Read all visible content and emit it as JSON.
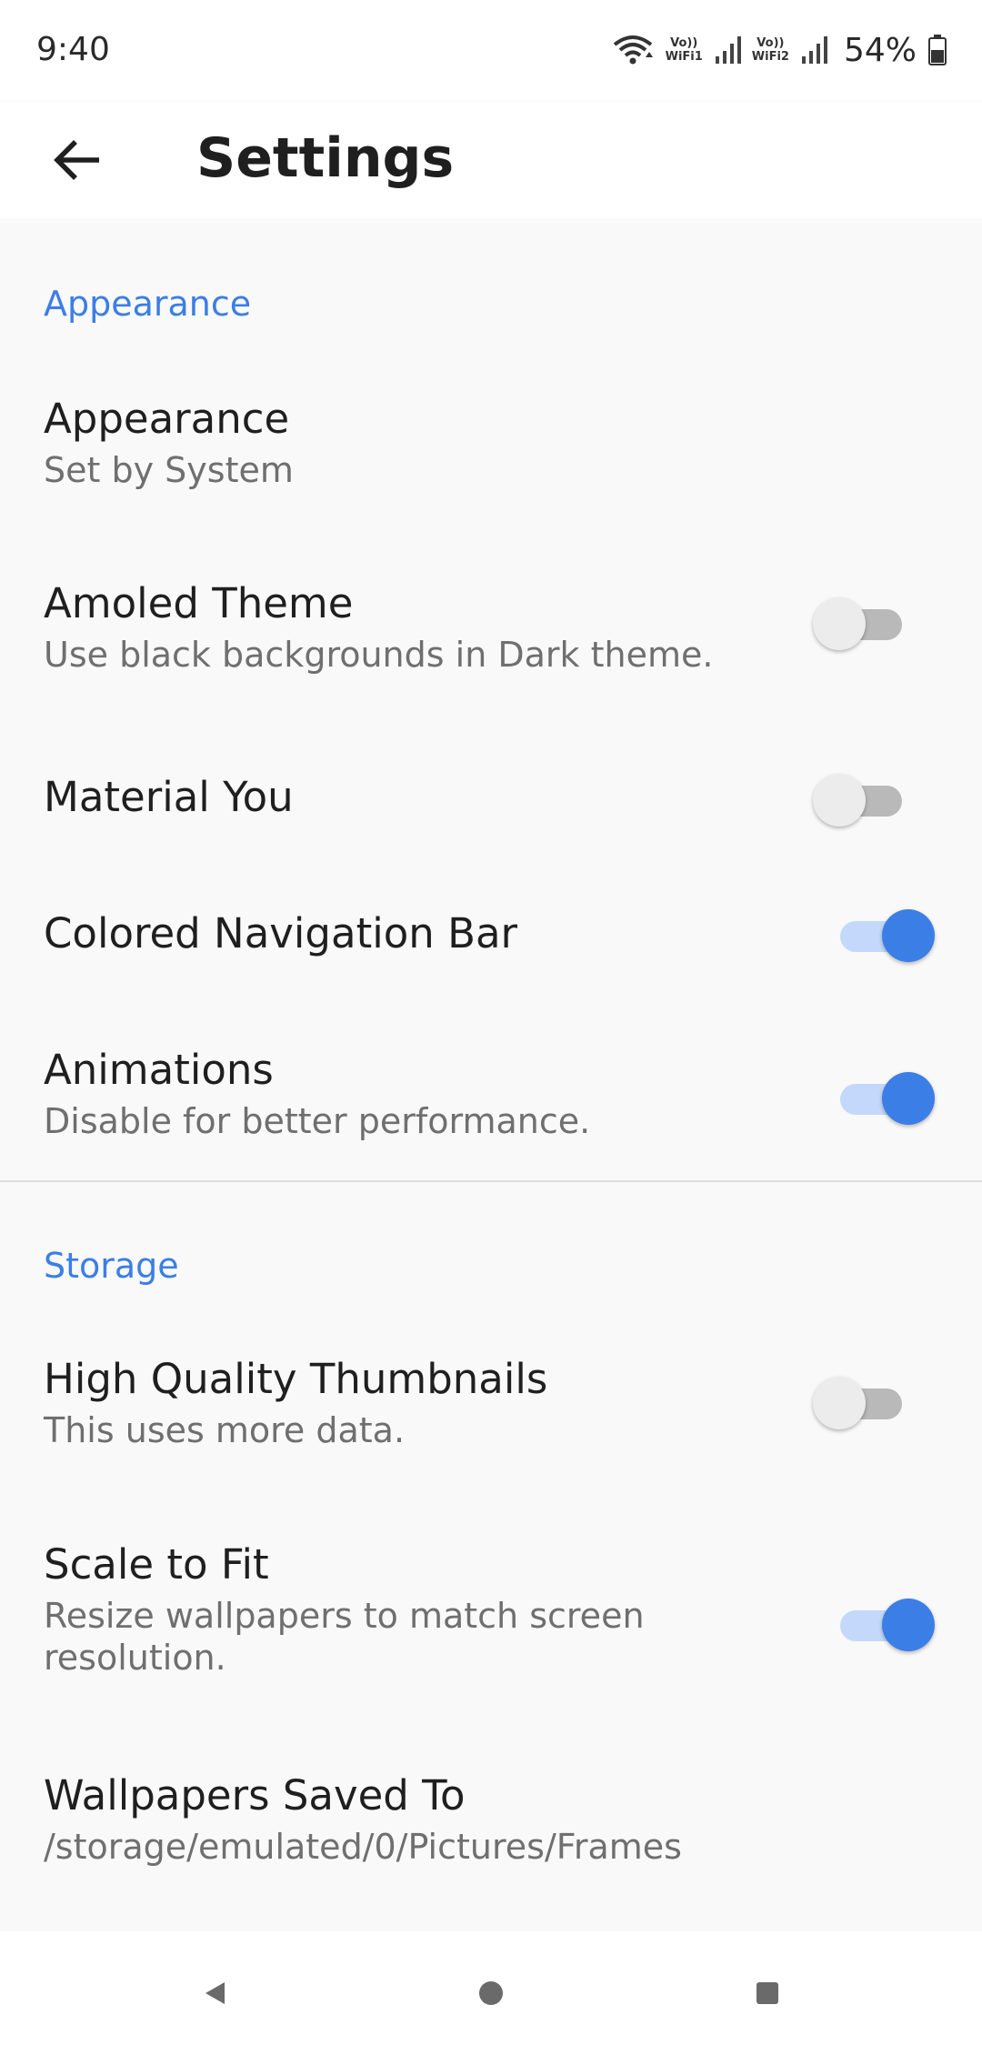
{
  "status_bar": {
    "time": "9:40",
    "sim1_label_top": "Vo))",
    "sim1_label_bottom": "WiFi1",
    "sim2_label_top": "Vo))",
    "sim2_label_bottom": "WiFi2",
    "battery_percent": "54%",
    "icons": [
      "wifi-icon",
      "signal-icon",
      "signal-icon",
      "battery-icon"
    ]
  },
  "app_bar": {
    "title": "Settings",
    "back_icon": "arrow-left-icon"
  },
  "sections": [
    {
      "header": "Appearance",
      "items": [
        {
          "title": "Appearance",
          "subtitle": "Set by System"
        },
        {
          "title": "Amoled Theme",
          "subtitle": "Use black backgrounds in Dark theme.",
          "toggle": false
        },
        {
          "title": "Material You",
          "toggle": false
        },
        {
          "title": "Colored Navigation Bar",
          "toggle": true
        },
        {
          "title": "Animations",
          "subtitle": "Disable for better performance.",
          "toggle": true
        }
      ]
    },
    {
      "header": "Storage",
      "items": [
        {
          "title": "High Quality Thumbnails",
          "subtitle": "This uses more data.",
          "toggle": false
        },
        {
          "title": "Scale to Fit",
          "subtitle": "Resize wallpapers to match screen resolution.",
          "toggle": true
        },
        {
          "title": "Wallpapers Saved To",
          "subtitle": "/storage/emulated/0/Pictures/Frames"
        }
      ]
    }
  ],
  "nav_bar": {
    "icons": [
      "back-triangle-icon",
      "home-circle-icon",
      "recents-square-icon"
    ]
  },
  "colors": {
    "accent": "#3b7ee6",
    "accent_track": "#c4d8fb",
    "off_track": "#b9b9b9",
    "off_thumb": "#ececec",
    "background": "#f9f9f9"
  }
}
